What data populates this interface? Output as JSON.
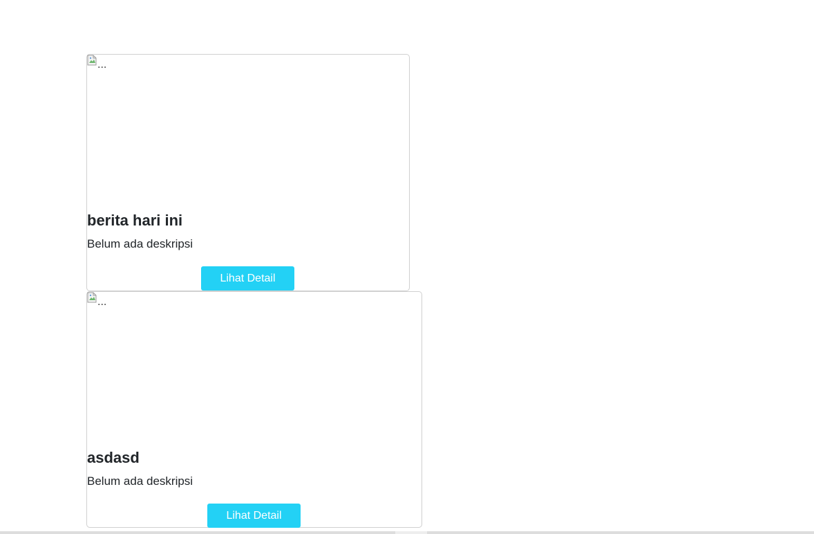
{
  "cards": [
    {
      "image_alt": "...",
      "title": "berita hari ini",
      "description": "Belum ada deskripsi",
      "button_label": "Lihat Detail"
    },
    {
      "image_alt": "...",
      "title": "asdasd",
      "description": "Belum ada deskripsi",
      "button_label": "Lihat Detail"
    }
  ],
  "colors": {
    "button_bg": "#23d1f5",
    "button_text": "#ffffff",
    "card_border": "#d0d0d0",
    "text": "#212529"
  },
  "icons": {
    "broken_image": "broken-image-icon"
  }
}
